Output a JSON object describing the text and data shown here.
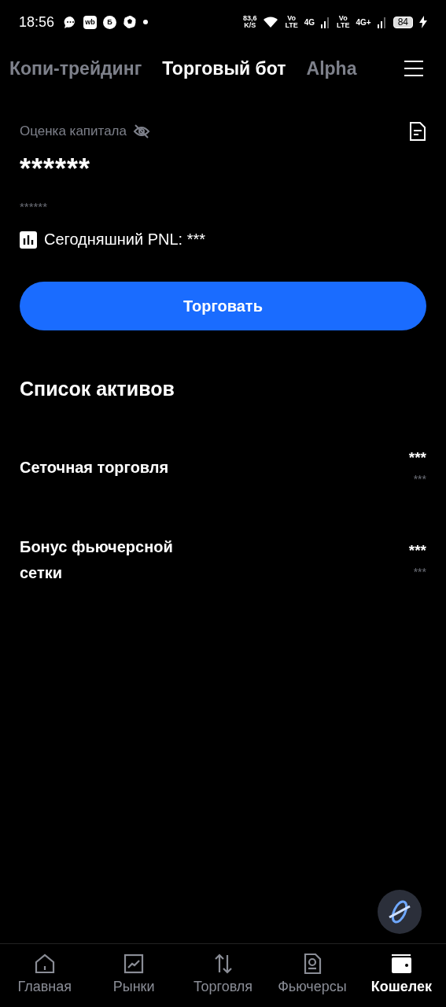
{
  "status_bar": {
    "time": "18:56",
    "app_badges": [
      {
        "kind": "chat"
      },
      {
        "kind": "text",
        "label": "wb"
      },
      {
        "kind": "circle",
        "label": "Б"
      },
      {
        "kind": "ball"
      },
      {
        "kind": "dot"
      }
    ],
    "speed": "83,6",
    "speed_unit": "K/S",
    "sims": [
      {
        "volte_top": "Vo",
        "volte_bottom": "LTE",
        "network": "4G"
      },
      {
        "volte_top": "Vo",
        "volte_bottom": "LTE",
        "network": "4G+"
      }
    ],
    "battery": "84"
  },
  "tabs": [
    {
      "label": "Копи-трейдинг",
      "selected": false
    },
    {
      "label": "Торговый бот",
      "selected": true
    },
    {
      "label": "Alpha",
      "selected": false
    }
  ],
  "capital": {
    "label": "Оценка капитала",
    "value": "******",
    "sub_value": "******",
    "pnl": "Сегодняшний PNL: ***"
  },
  "trade_button": "Торговать",
  "assets": {
    "title": "Список активов",
    "rows": [
      {
        "name": "Сеточная торговля",
        "value": "***",
        "sub_value": "***"
      },
      {
        "name": "Бонус фьючерсной сетки",
        "value": "***",
        "sub_value": "***"
      }
    ]
  },
  "nav": [
    {
      "label": "Главная",
      "kind": "home",
      "selected": false
    },
    {
      "label": "Рынки",
      "kind": "chart",
      "selected": false
    },
    {
      "label": "Торговля",
      "kind": "arrows",
      "selected": false
    },
    {
      "label": "Фьючерсы",
      "kind": "document",
      "selected": false
    },
    {
      "label": "Кошелек",
      "kind": "wallet",
      "selected": true
    }
  ]
}
